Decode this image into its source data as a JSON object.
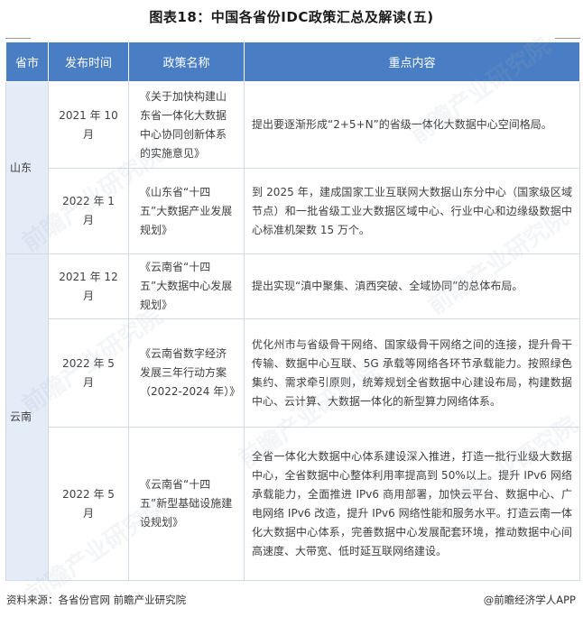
{
  "title": "图表18：中国各省份IDC政策汇总及解读(五)",
  "table": {
    "headers": [
      "省市",
      "发布时间",
      "政策名称",
      "重点内容"
    ],
    "provinces": [
      "山东",
      "云南"
    ],
    "rows": [
      {
        "date": "2021 年 10 月",
        "policy": "《关于加快构建山东省一体化大数据中心协同创新体系的实施意见》",
        "content": "提出要逐渐形成“2+5+N”的省级一体化大数据中心空间格局。"
      },
      {
        "date": "2022 年 1 月",
        "policy": "《山东省“十四五”大数据产业发展规划》",
        "content": "到 2025 年，建成国家工业互联网大数据山东分中心（国家级区域节点）和一批省级工业大数据区域中心、行业中心和边缘级数据中心标准机架数 15 万个。"
      },
      {
        "date": "2021 年 12 月",
        "policy": "《云南省“十四五”大数据中心发展规划》",
        "content": "提出实现“滇中聚集、滇西突破、全域协同”的总体布局。"
      },
      {
        "date": "2022 年 5 月",
        "policy": "《云南省数字经济发展三年行动方案（2022-2024 年）》",
        "content": "优化州市与省级骨干网络、国家级骨干网络之间的连接，提升骨干传输、数据中心互联、5G 承载等网络各环节承载能力。按照绿色集约、需求牵引原则，统筹规划全省数据中心建设布局，构建数据中心、云计算、大数据一体化的新型算力网络体系。"
      },
      {
        "date": "2022 年 5 月",
        "policy": "《云南省“十四五”新型基础设施建设规划》",
        "content": "全省一体化大数据中心体系建设深入推进，打造一批行业级大数据中心，全省数据中心整体利用率提高到 50%以上。提升 IPv6 网络承载能力，全面推进 IPv6 商用部署，加快云平台、数据中心、广电网络 IPv6 改造，提升 IPv6 网络性能和服务水平。打造云南一体化大数据中心体系，完善数据中心发展配套环境，推动数据中心间高速度、大带宽、低时延互联网络建设。"
      }
    ]
  },
  "footer": {
    "source": "资料来源：各省份官网 前瞻产业研究院",
    "brand": "@前瞻经济学人APP"
  },
  "watermark": "前瞻产业研究院",
  "colors": {
    "header_bg": "#4a7ec4",
    "province_bg": "#e3ecf7",
    "border": "#d3dbe6"
  }
}
